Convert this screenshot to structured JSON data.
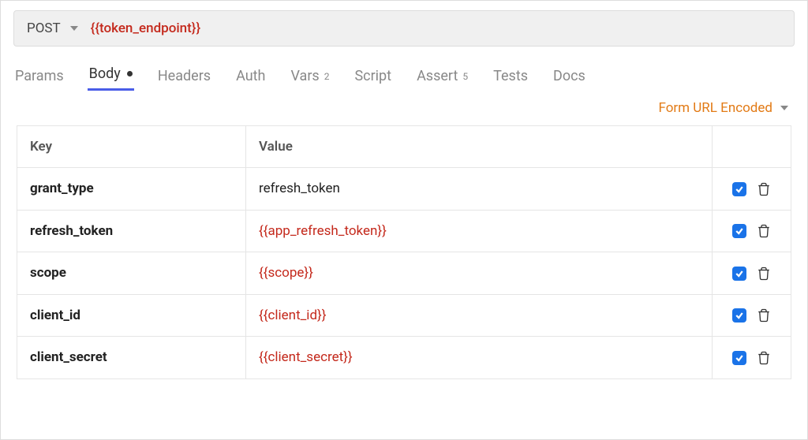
{
  "request": {
    "method": "POST",
    "url": "{{token_endpoint}}"
  },
  "tabs": {
    "params": "Params",
    "body": "Body",
    "headers": "Headers",
    "auth": "Auth",
    "vars": "Vars",
    "vars_badge": "2",
    "script": "Script",
    "assert": "Assert",
    "assert_badge": "5",
    "tests": "Tests",
    "docs": "Docs",
    "active": "body",
    "body_modified": true
  },
  "body": {
    "type_label": "Form URL Encoded",
    "headers": {
      "key": "Key",
      "value": "Value"
    },
    "rows": [
      {
        "key": "grant_type",
        "value": "refresh_token",
        "is_variable": false,
        "enabled": true
      },
      {
        "key": "refresh_token",
        "value": "{{app_refresh_token}}",
        "is_variable": true,
        "enabled": true
      },
      {
        "key": "scope",
        "value": "{{scope}}",
        "is_variable": true,
        "enabled": true
      },
      {
        "key": "client_id",
        "value": "{{client_id}}",
        "is_variable": true,
        "enabled": true
      },
      {
        "key": "client_secret",
        "value": "{{client_secret}}",
        "is_variable": true,
        "enabled": true
      }
    ]
  }
}
